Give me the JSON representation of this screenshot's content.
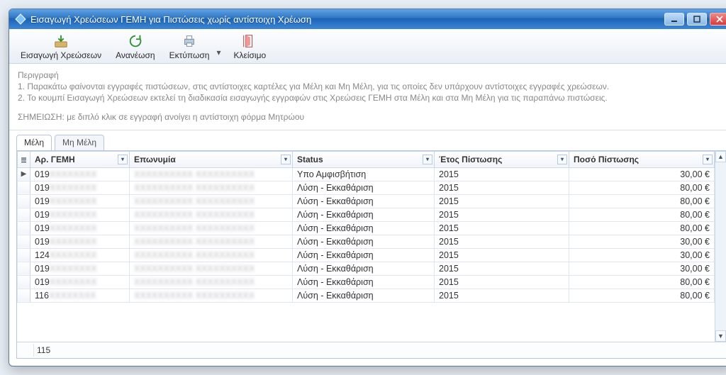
{
  "window": {
    "title": "Εισαγωγή Χρεώσεων ΓΕΜΗ για Πιστώσεις χωρίς αντίστοιχη Χρέωση"
  },
  "toolbar": {
    "import_charges": "Εισαγωγή Χρεώσεων",
    "refresh": "Ανανέωση",
    "print": "Εκτύπωση",
    "close": "Κλείσιμο"
  },
  "description": {
    "heading": "Περιγραφή",
    "line1": "1.  Παρακάτω φαίνονται εγγραφές πιστώσεων, στις αντίστοιχες καρτέλες για Μέλη και Μη Μέλη, για τις οποίες δεν υπάρχουν αντίστοιχες εγγραφές χρεώσεων.",
    "line2": "2.  Το κουμπί Εισαγωγή Χρεώσεων εκτελεί τη διαδικασία εισαγωγής εγγραφών στις Χρεώσεις ΓΕΜΗ στα Μέλη και στα Μη Μέλη για τις παραπάνω πιστώσεις.",
    "note": "ΣΗΜΕΙΩΣΗ: με διπλό κλικ σε εγγραφή ανοίγει η αντίστοιχη φόρμα Μητρώου"
  },
  "tabs": {
    "members": "Μέλη",
    "nonmembers": "Μη Μέλη"
  },
  "columns": {
    "ar_gemh": "Αρ. ΓΕΜΗ",
    "name": "Επωνυμία",
    "status": "Status",
    "year": "Έτος Πίστωσης",
    "amount": "Ποσό Πίστωσης"
  },
  "rows": [
    {
      "ar": "019",
      "name": "—",
      "status": "Υπο Αμφισβήτιση",
      "year": "2015",
      "amount": "30,00 €"
    },
    {
      "ar": "019",
      "name": "—",
      "status": "Λύση - Εκκαθάριση",
      "year": "2015",
      "amount": "80,00 €"
    },
    {
      "ar": "019",
      "name": "—",
      "status": "Λύση - Εκκαθάριση",
      "year": "2015",
      "amount": "80,00 €"
    },
    {
      "ar": "019",
      "name": "—",
      "status": "Λύση - Εκκαθάριση",
      "year": "2015",
      "amount": "80,00 €"
    },
    {
      "ar": "019",
      "name": "—",
      "status": "Λύση - Εκκαθάριση",
      "year": "2015",
      "amount": "80,00 €"
    },
    {
      "ar": "019",
      "name": "—",
      "status": "Λύση - Εκκαθάριση",
      "year": "2015",
      "amount": "30,00 €"
    },
    {
      "ar": "124",
      "name": "—",
      "status": "Λύση - Εκκαθάριση",
      "year": "2015",
      "amount": "30,00 €"
    },
    {
      "ar": "019",
      "name": "—",
      "status": "Λύση - Εκκαθάριση",
      "year": "2015",
      "amount": "30,00 €"
    },
    {
      "ar": "019",
      "name": "—",
      "status": "Λύση - Εκκαθάριση",
      "year": "2015",
      "amount": "80,00 €"
    },
    {
      "ar": "116",
      "name": "—",
      "status": "Λύση - Εκκαθάριση",
      "year": "2015",
      "amount": "80,00 €"
    }
  ],
  "footer": {
    "count": "115"
  }
}
